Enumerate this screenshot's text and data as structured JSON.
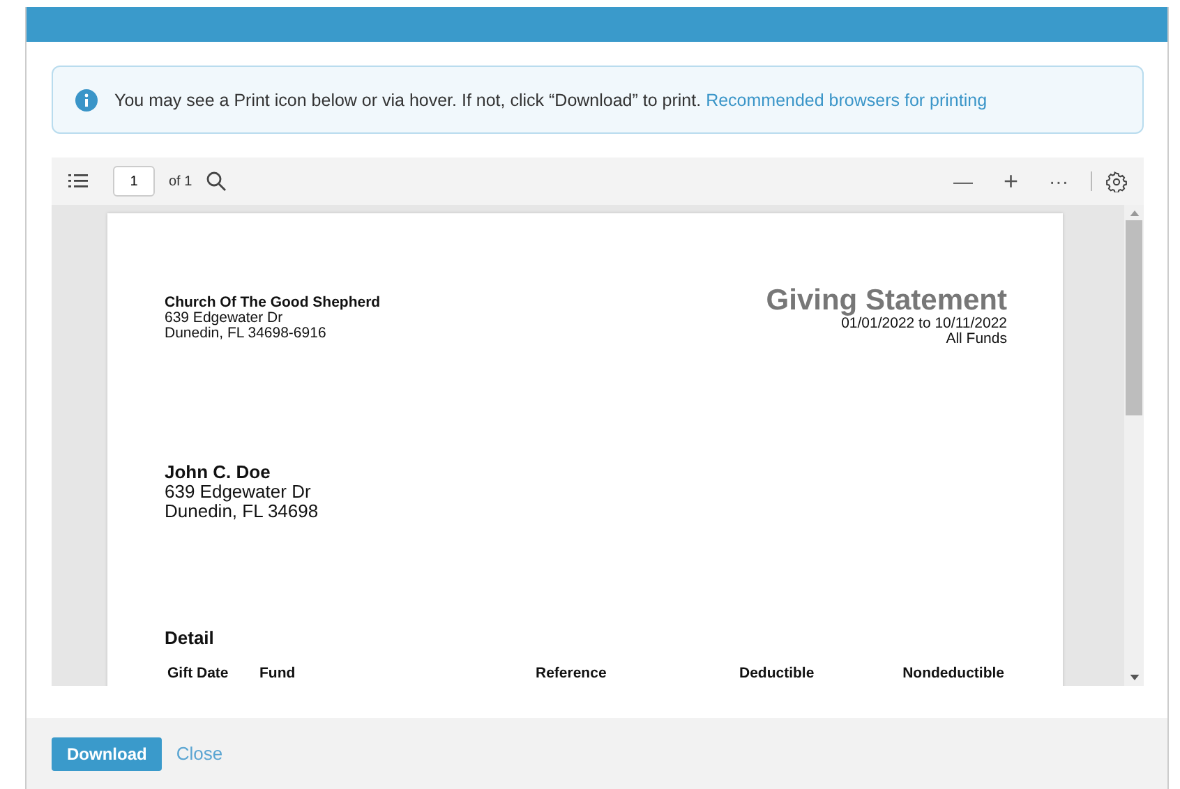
{
  "notice": {
    "text": "You may see a Print icon below or via hover. If not, click “Download” to print.",
    "link": "Recommended browsers for printing"
  },
  "viewer": {
    "page_number": "1",
    "page_count": "of 1",
    "zoom_out": "—",
    "zoom_in": "+",
    "more": "···"
  },
  "document": {
    "sender": {
      "name": "Church Of The Good Shepherd",
      "lines": [
        "639 Edgewater Dr",
        "Dunedin, FL 34698-6916"
      ]
    },
    "title": "Giving Statement",
    "period": "01/01/2022 to 10/11/2022",
    "funds": "All Funds",
    "recipient": {
      "name": "John C. Doe",
      "lines": [
        "639 Edgewater Dr",
        "Dunedin, FL 34698"
      ]
    },
    "section": "Detail",
    "columns": [
      "Gift Date",
      "Fund",
      "Reference",
      "Deductible",
      "Nondeductible"
    ]
  },
  "buttons": {
    "download": "Download",
    "close": "Close"
  }
}
